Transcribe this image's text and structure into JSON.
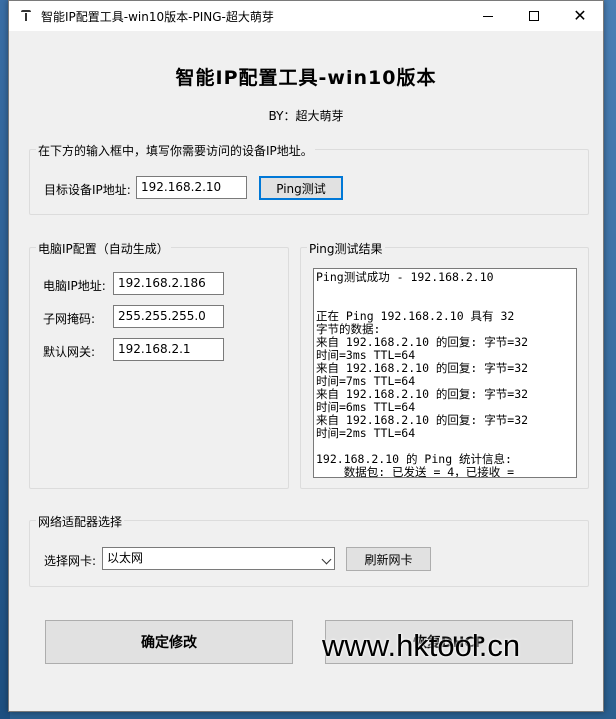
{
  "window": {
    "title": "智能IP配置工具-win10版本-PING-超大萌芽"
  },
  "header": {
    "heading": "智能IP配置工具-win10版本",
    "byline": "BY：超大萌芽"
  },
  "target": {
    "instruction": "在下方的输入框中，填写你需要访问的设备IP地址。",
    "ip_label": "目标设备IP地址:",
    "ip_value": "192.168.2.10",
    "ping_button": "Ping测试"
  },
  "pc_config": {
    "group_title": "电脑IP配置（自动生成）",
    "ip_label": "电脑IP地址:",
    "ip_value": "192.168.2.186",
    "mask_label": "子网掩码:",
    "mask_value": "255.255.255.0",
    "gateway_label": "默认网关:",
    "gateway_value": "192.168.2.1"
  },
  "ping_result": {
    "group_title": "Ping测试结果",
    "text": "Ping测试成功 - 192.168.2.10\n\n\n正在 Ping 192.168.2.10 具有 32\n字节的数据:\n来自 192.168.2.10 的回复: 字节=32\n时间=3ms TTL=64\n来自 192.168.2.10 的回复: 字节=32\n时间=7ms TTL=64\n来自 192.168.2.10 的回复: 字节=32\n时间=6ms TTL=64\n来自 192.168.2.10 的回复: 字节=32\n时间=2ms TTL=64\n\n192.168.2.10 的 Ping 统计信息:\n    数据包: 已发送 = 4，已接收 ="
  },
  "adapter": {
    "group_title": "网络适配器选择",
    "select_label": "选择网卡:",
    "selected": "以太网",
    "refresh_button": "刷新网卡"
  },
  "actions": {
    "confirm_button": "确定修改",
    "restore_button": "恢复DHCP"
  },
  "watermark": "www.hktool.cn"
}
